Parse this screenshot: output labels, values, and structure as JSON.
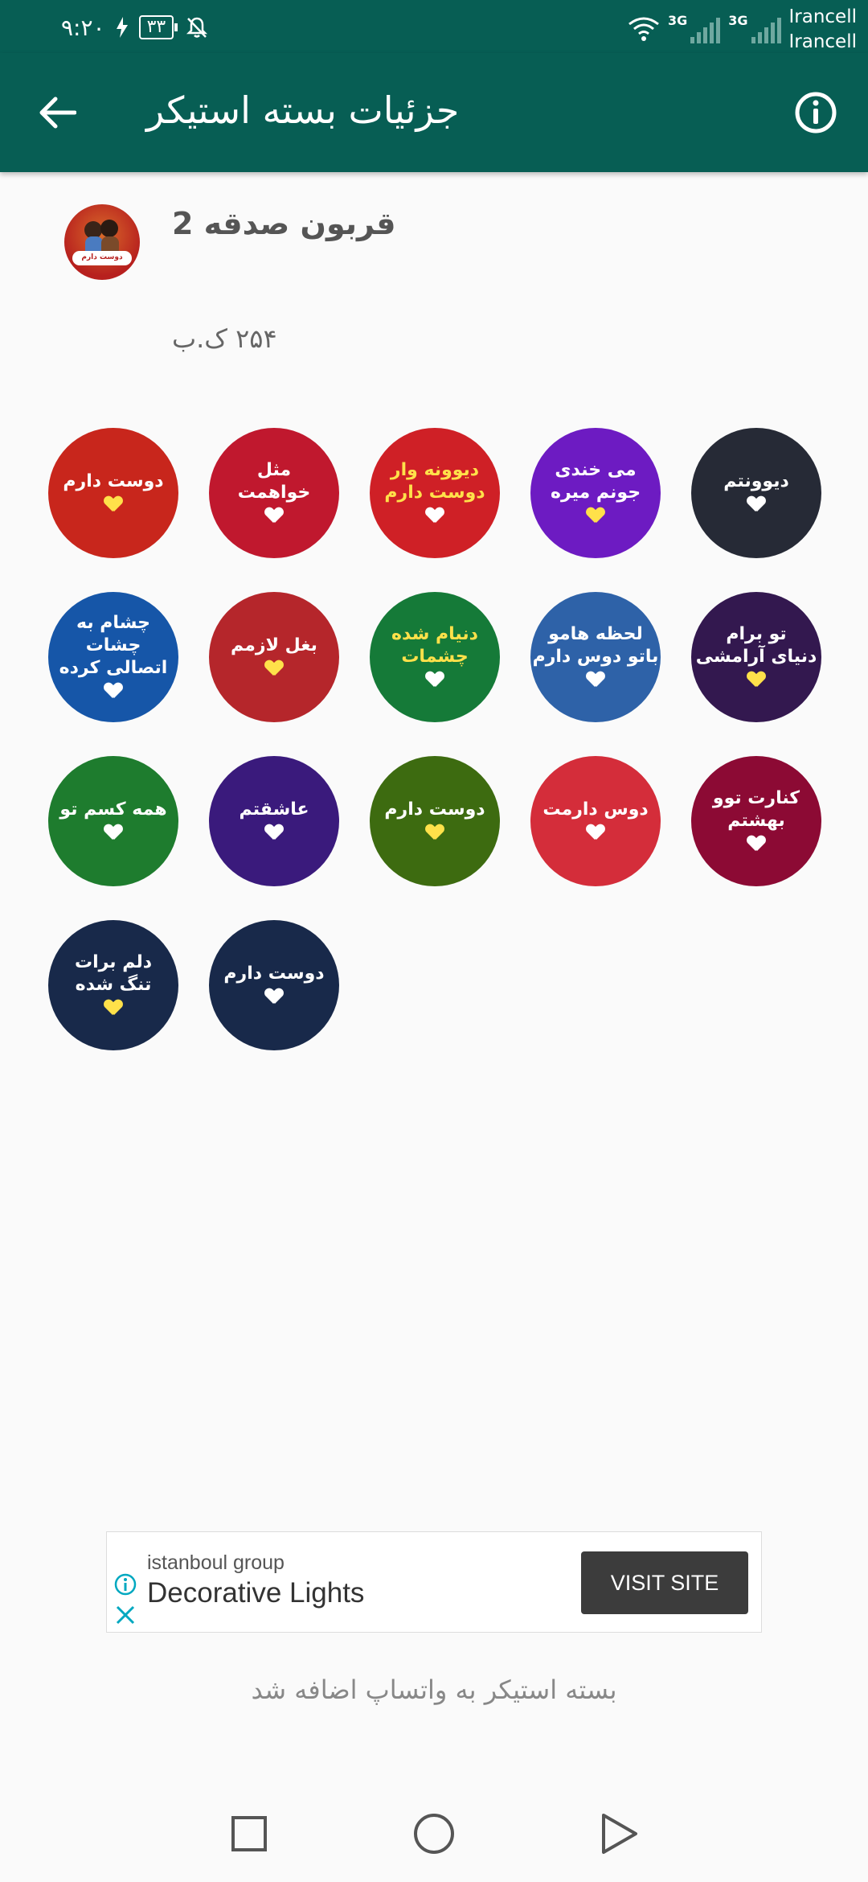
{
  "status_bar": {
    "time": "۹:۲۰",
    "battery": "۳۳",
    "carrier_1": "Irancell",
    "carrier_2": "Irancell",
    "network_1": "3G",
    "network_2": "3G"
  },
  "app_bar": {
    "title": "جزئیات بسته استیکر",
    "back_icon": "arrow-left-icon",
    "info_icon": "info-icon"
  },
  "pack": {
    "name": "قربون صدقه 2",
    "size": "۲۵۴ ک.ب",
    "icon_text": "دوست دارم"
  },
  "stickers": [
    {
      "line1": "دوست دارم",
      "line2": "",
      "bg": "#c8261c",
      "fg": "#ffffff"
    },
    {
      "line1": "مثل",
      "line2": "خواهمت",
      "bg": "#c0182e",
      "fg": "#ffffff"
    },
    {
      "line1": "دیوونه وار",
      "line2": "دوست دارم",
      "bg": "#cf2026",
      "fg": "#ffe14a"
    },
    {
      "line1": "می خندی",
      "line2": "جونم میره",
      "bg": "#6d1bc2",
      "fg": "#ffffff"
    },
    {
      "line1": "دیوونتم",
      "line2": "",
      "bg": "#262a36",
      "fg": "#ffffff"
    },
    {
      "line1": "چشام به چشات",
      "line2": "اتصالی کرده",
      "bg": "#1656a8",
      "fg": "#ffffff"
    },
    {
      "line1": "بغل لازمم",
      "line2": "",
      "bg": "#b5262b",
      "fg": "#ffffff"
    },
    {
      "line1": "دنیام شده",
      "line2": "چشمات",
      "bg": "#157a38",
      "fg": "#ffe14a"
    },
    {
      "line1": "لحظه هامو",
      "line2": "باتو دوس دارم",
      "bg": "#2e62a8",
      "fg": "#ffffff"
    },
    {
      "line1": "تو برام",
      "line2": "دنیای آرامشی",
      "bg": "#33184f",
      "fg": "#ffffff"
    },
    {
      "line1": "همه کسم تو",
      "line2": "",
      "bg": "#1e7c2e",
      "fg": "#ffffff"
    },
    {
      "line1": "عاشقتم",
      "line2": "",
      "bg": "#3a1a7c",
      "fg": "#ffffff"
    },
    {
      "line1": "دوست دارم",
      "line2": "",
      "bg": "#3d6b10",
      "fg": "#ffffff"
    },
    {
      "line1": "دوس دارمت",
      "line2": "",
      "bg": "#d42d3a",
      "fg": "#ffffff"
    },
    {
      "line1": "کنارت توو",
      "line2": "بهشتم",
      "bg": "#8c0a34",
      "fg": "#ffffff"
    },
    {
      "line1": "دلم برات",
      "line2": "تنگ شده",
      "bg": "#18294a",
      "fg": "#ffffff"
    },
    {
      "line1": "دوست دارم",
      "line2": "",
      "bg": "#18294a",
      "fg": "#ffffff"
    }
  ],
  "ad": {
    "advertiser": "istanboul group",
    "headline": "Decorative Lights",
    "cta": "VISIT SITE"
  },
  "added_message": "بسته استیکر به واتساپ اضافه شد",
  "nav": {
    "recents_icon": "square-icon",
    "home_icon": "circle-icon",
    "back_icon": "triangle-back-icon"
  },
  "colors": {
    "app_bar": "#075e54",
    "background": "#fafafa"
  }
}
